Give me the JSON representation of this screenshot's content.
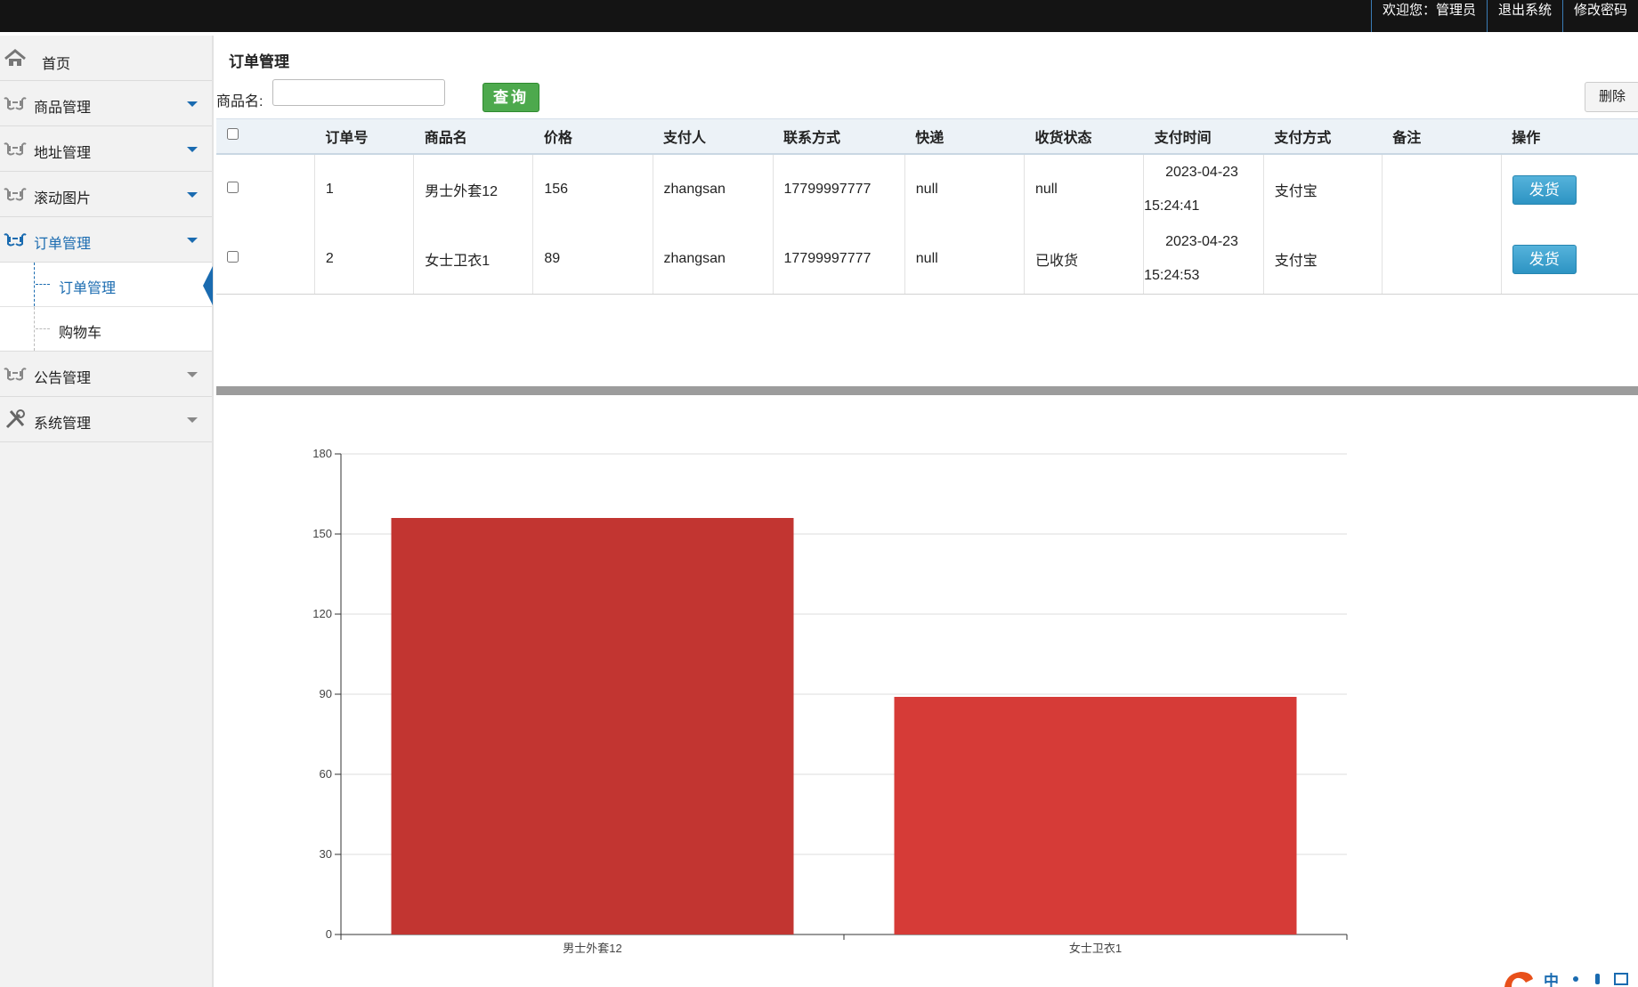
{
  "topbar": {
    "welcome": "欢迎您：管理员",
    "logout": "退出系统",
    "change_password": "修改密码"
  },
  "sidebar": {
    "items": [
      {
        "label": "首页",
        "icon": "home-icon"
      },
      {
        "label": "商品管理",
        "icon": "hands-icon"
      },
      {
        "label": "地址管理",
        "icon": "hands-icon"
      },
      {
        "label": "滚动图片",
        "icon": "hands-icon"
      },
      {
        "label": "订单管理",
        "icon": "hands-icon"
      },
      {
        "label": "公告管理",
        "icon": "hands-icon"
      },
      {
        "label": "系统管理",
        "icon": "tools-icon"
      }
    ],
    "submenu": [
      {
        "label": "订单管理"
      },
      {
        "label": "购物车"
      }
    ]
  },
  "main": {
    "title": "订单管理",
    "search_label": "商品名:",
    "search_value": "",
    "query_button": "查询",
    "delete_button": "删除"
  },
  "table": {
    "headers": [
      "订单号",
      "商品名",
      "价格",
      "支付人",
      "联系方式",
      "快递",
      "收货状态",
      "支付时间",
      "支付方式",
      "备注",
      "操作"
    ],
    "rows": [
      {
        "id": "1",
        "product": "男士外套12",
        "price": "156",
        "payer": "zhangsan",
        "contact": "17799997777",
        "express": "null",
        "status": "null",
        "pay_date": "2023-04-23",
        "pay_time": "15:24:41",
        "pay_method": "支付宝",
        "remark": "",
        "action": "发货"
      },
      {
        "id": "2",
        "product": "女士卫衣1",
        "price": "89",
        "payer": "zhangsan",
        "contact": "17799997777",
        "express": "null",
        "status": "已收货",
        "pay_date": "2023-04-23",
        "pay_time": "15:24:53",
        "pay_method": "支付宝",
        "remark": "",
        "action": "发货"
      }
    ]
  },
  "chart_data": {
    "type": "bar",
    "categories": [
      "男士外套12",
      "女士卫衣1"
    ],
    "values": [
      156,
      89
    ],
    "ylim": [
      0,
      180
    ],
    "yticks": [
      0,
      30,
      60,
      90,
      120,
      150,
      180
    ],
    "bar_colors": [
      "#c23531",
      "#d63b37"
    ],
    "grid": true
  },
  "ime": {
    "label": "中"
  }
}
